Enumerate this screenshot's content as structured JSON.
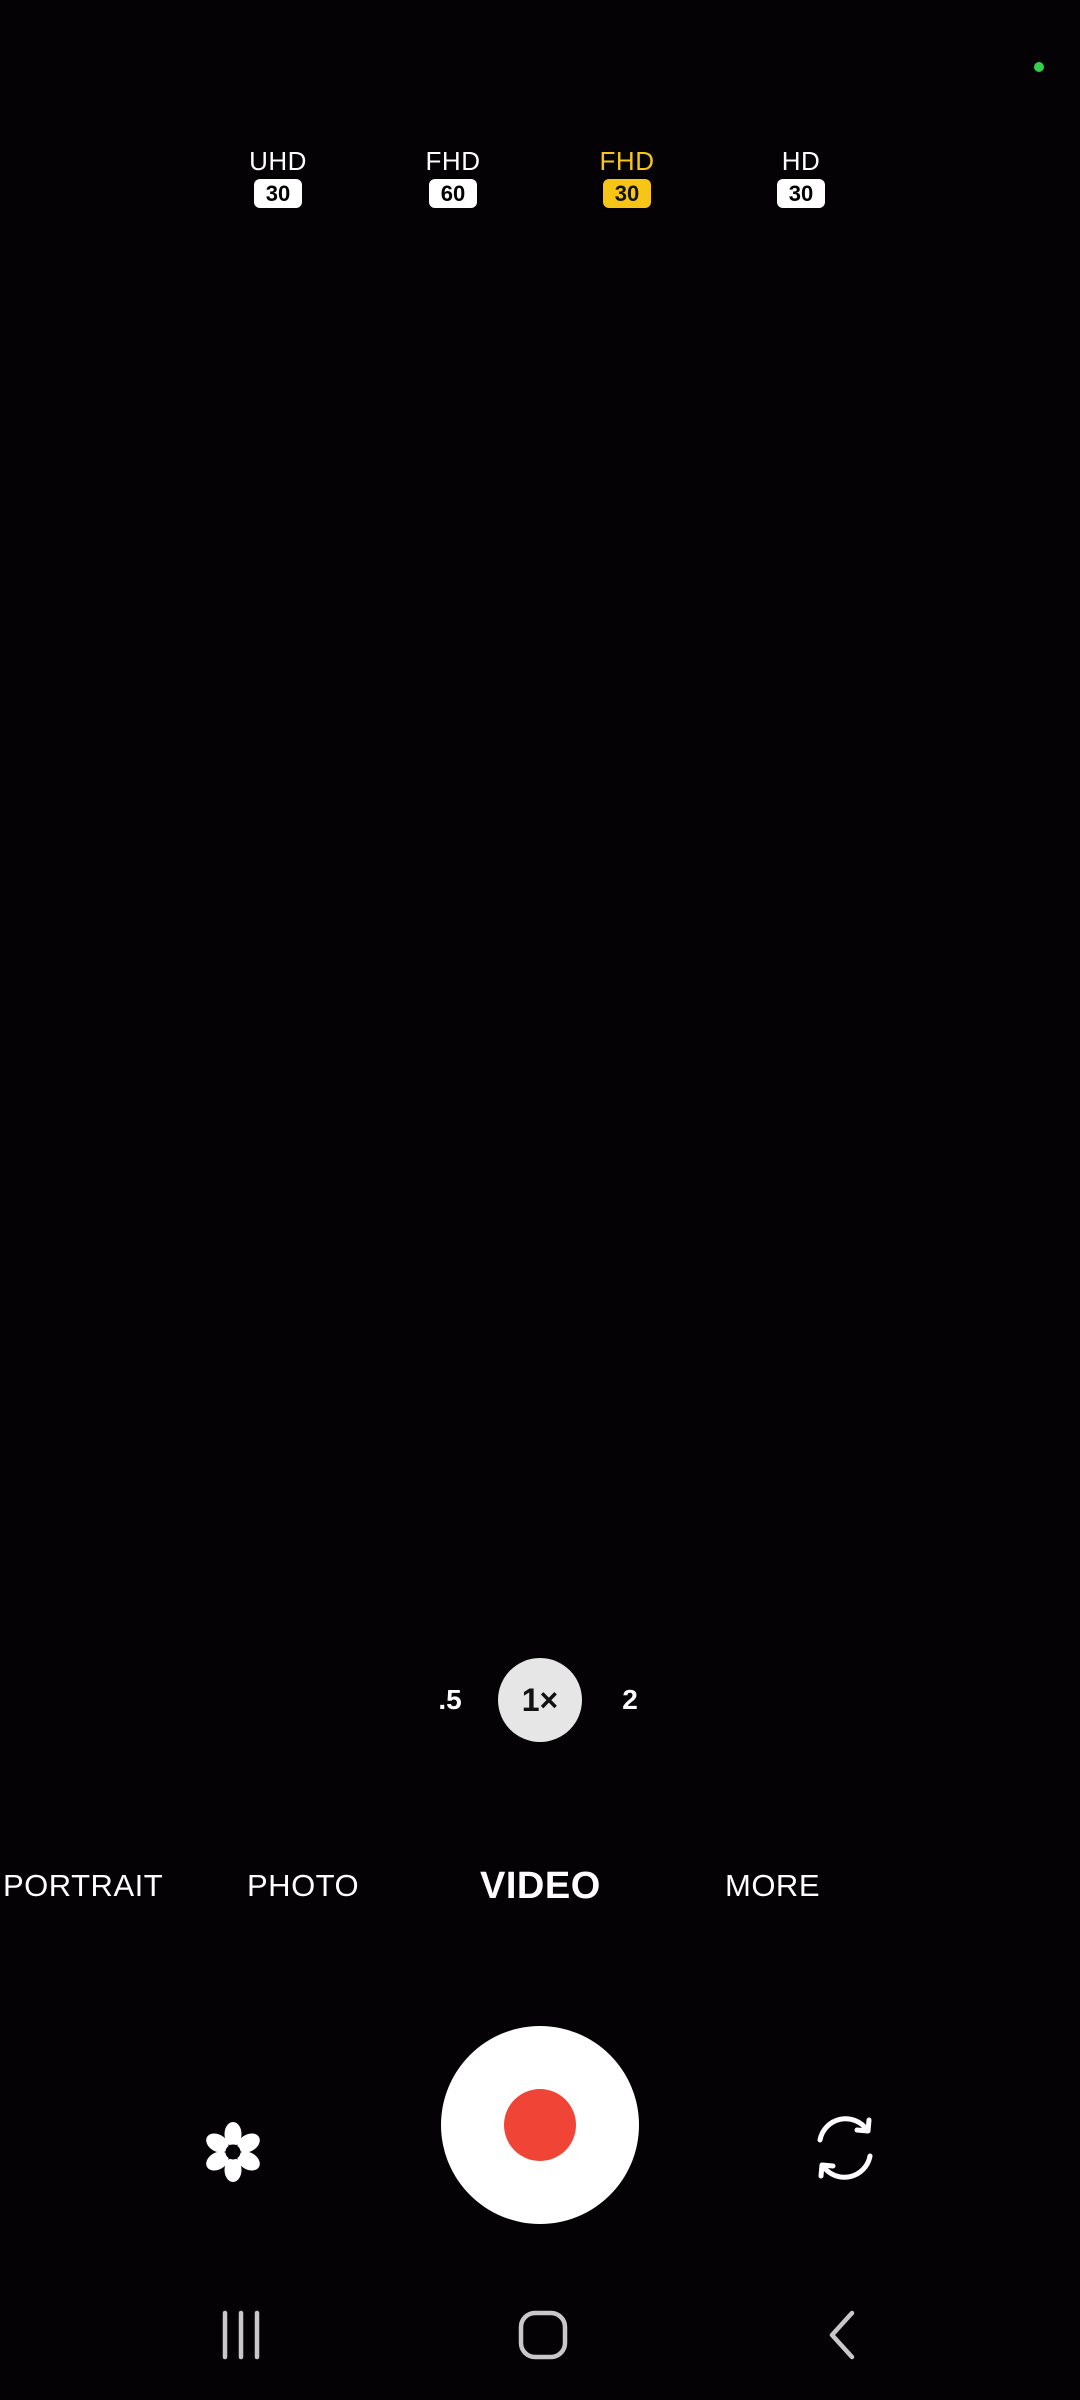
{
  "status": {
    "indicator_color": "#35d04a"
  },
  "resolutions": [
    {
      "label": "UHD",
      "fps": "30",
      "selected": false
    },
    {
      "label": "FHD",
      "fps": "60",
      "selected": false
    },
    {
      "label": "FHD",
      "fps": "30",
      "selected": true
    },
    {
      "label": "HD",
      "fps": "30",
      "selected": false
    }
  ],
  "zoom": {
    "options": [
      ".5",
      "1×",
      "2"
    ],
    "active": "1×"
  },
  "modes": {
    "items": [
      "PORTRAIT",
      "PHOTO",
      "VIDEO",
      "MORE"
    ],
    "active": "VIDEO"
  },
  "controls": {
    "left_icon": "effects-flower-icon",
    "record_icon": "record-icon",
    "right_icon": "switch-camera-icon",
    "record_color": "#f04436",
    "accent_color": "#f6c515"
  },
  "navigation": {
    "recents_icon": "recents-icon",
    "home_icon": "home-icon",
    "back_icon": "back-icon"
  }
}
